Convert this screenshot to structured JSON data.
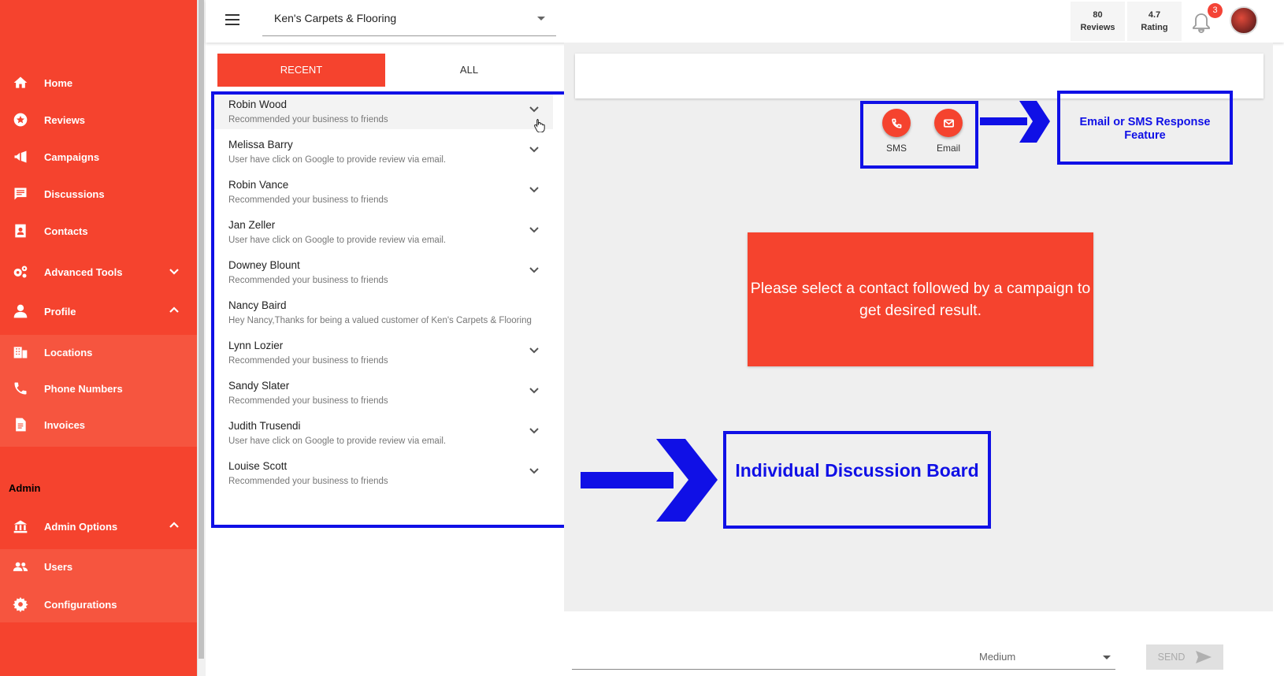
{
  "sidebar": {
    "items": [
      {
        "label": "Home",
        "icon": "home-icon"
      },
      {
        "label": "Reviews",
        "icon": "star-icon"
      },
      {
        "label": "Campaigns",
        "icon": "megaphone-icon"
      },
      {
        "label": "Discussions",
        "icon": "chat-icon"
      },
      {
        "label": "Contacts",
        "icon": "contact-book-icon"
      },
      {
        "label": "Advanced Tools",
        "icon": "gears-icon"
      },
      {
        "label": "Profile",
        "icon": "person-icon"
      },
      {
        "label": "Locations",
        "icon": "building-icon"
      },
      {
        "label": "Phone Numbers",
        "icon": "phone-icon"
      },
      {
        "label": "Invoices",
        "icon": "document-icon"
      }
    ],
    "admin_heading": "Admin",
    "admin_items": [
      {
        "label": "Admin Options",
        "icon": "bank-icon"
      },
      {
        "label": "Users",
        "icon": "users-icon"
      },
      {
        "label": "Configurations",
        "icon": "gear-icon"
      }
    ]
  },
  "header": {
    "business_name": "Ken's Carpets & Flooring",
    "reviews_count": "80",
    "reviews_label": "Reviews",
    "rating_value": "4.7",
    "rating_label": "Rating",
    "notification_count": "3"
  },
  "tabs": {
    "recent": "RECENT",
    "all": "ALL"
  },
  "contacts": [
    {
      "name": "Robin Wood",
      "message": "Recommended your business to friends"
    },
    {
      "name": "Melissa Barry",
      "message": "User have click on Google to provide review via email."
    },
    {
      "name": "Robin Vance",
      "message": "Recommended your business to friends"
    },
    {
      "name": "Jan Zeller",
      "message": "User have click on Google to provide review via email."
    },
    {
      "name": "Downey Blount",
      "message": "Recommended your business to friends"
    },
    {
      "name": "Nancy Baird",
      "message": "Hey Nancy,Thanks for being a valued customer of Ken's Carpets & Flooring"
    },
    {
      "name": "Lynn Lozier",
      "message": "Recommended your business to friends"
    },
    {
      "name": "Sandy Slater",
      "message": "Recommended your business to friends"
    },
    {
      "name": "Judith Trusendi",
      "message": "User have click on Google to provide review via email."
    },
    {
      "name": "Louise Scott",
      "message": "Recommended your business to friends"
    }
  ],
  "actions": {
    "sms_label": "SMS",
    "email_label": "Email"
  },
  "annotations": {
    "feature": "Email or SMS Response Feature",
    "board": "Individual Discussion Board"
  },
  "notice": "Please select a contact followed by a campaign to get desired result.",
  "footer": {
    "medium_value": "Medium",
    "send_label": "SEND"
  },
  "colors": {
    "brand": "#f5432e",
    "annotation": "#1010e6"
  }
}
